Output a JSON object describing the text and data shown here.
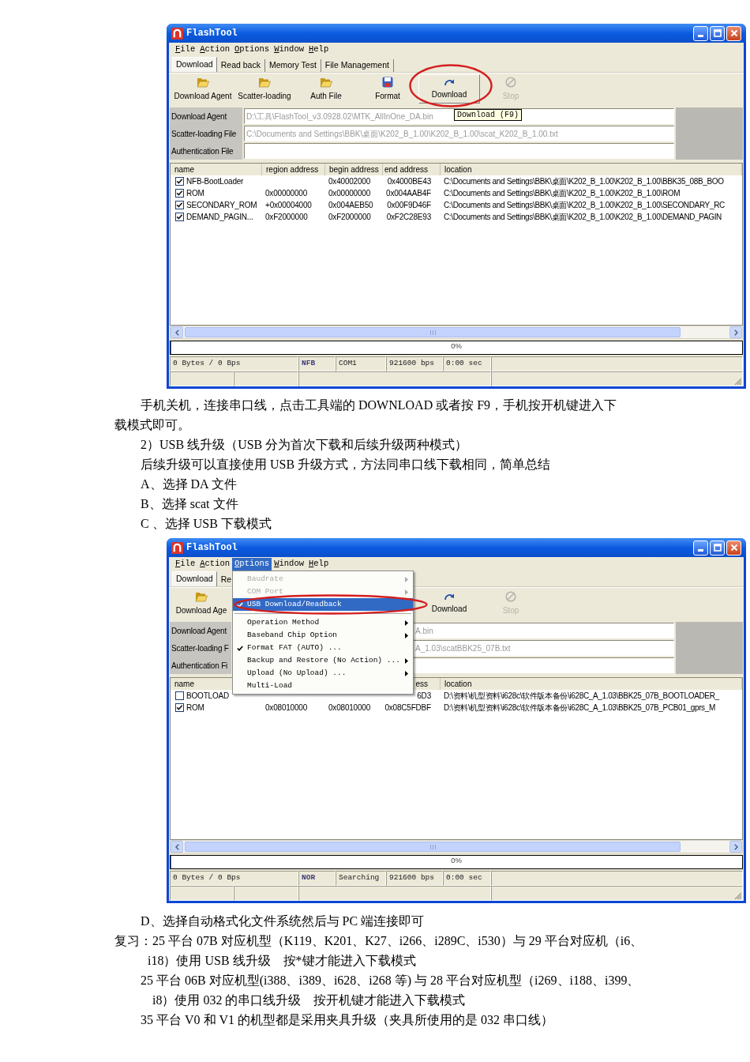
{
  "screenshot_1": {
    "title": "FlashTool",
    "menu_bar": [
      {
        "label": "File",
        "selected": false
      },
      {
        "label": "Action",
        "selected": false
      },
      {
        "label": "Options",
        "selected": false
      },
      {
        "label": "Window",
        "selected": false
      },
      {
        "label": "Help",
        "selected": false
      }
    ],
    "tabs": [
      {
        "label": "Download",
        "selected": true
      },
      {
        "label": "Read back",
        "selected": false
      },
      {
        "label": "Memory Test",
        "selected": false
      },
      {
        "label": "File Management",
        "selected": false
      }
    ],
    "toolbar": [
      {
        "label": "Download Agent",
        "kind": "folder",
        "disabled": false,
        "highlighted": false,
        "circled": false
      },
      {
        "label": "Scatter-loading",
        "kind": "folder",
        "disabled": false,
        "highlighted": false,
        "circled": false
      },
      {
        "label": "Auth File",
        "kind": "folder",
        "disabled": false,
        "highlighted": false,
        "circled": false
      },
      {
        "label": "Format",
        "kind": "format",
        "disabled": false,
        "highlighted": false,
        "circled": false
      },
      {
        "label": "Download",
        "kind": "download",
        "disabled": false,
        "highlighted": true,
        "circled": true
      },
      {
        "label": "Stop",
        "kind": "stop",
        "disabled": true,
        "highlighted": false,
        "circled": false
      }
    ],
    "tooltip": "Download (F9)",
    "fields": [
      {
        "label": "Download Agent",
        "value": "D:\\工具\\FlashTool_v3.0928.02\\MTK_AllInOne_DA.bin"
      },
      {
        "label": "Scatter-loading File",
        "value": "C:\\Documents and Settings\\BBK\\桌面\\K202_B_1.00\\K202_B_1.00\\scat_K202_B_1.00.txt"
      },
      {
        "label": "Authentication File"
      }
    ],
    "table": {
      "columns": {
        "name": "name",
        "region_address": "region address",
        "begin_address": "begin address",
        "end_address": "end address",
        "location": "location"
      },
      "rows": [
        {
          "checked": true,
          "name": "NFB-BootLoader",
          "begin_address": "0x40002000",
          "end_address": "0x4000BE43",
          "location": "C:\\Documents and Settings\\BBK\\桌面\\K202_B_1.00\\K202_B_1.00\\BBK35_08B_BOO"
        },
        {
          "checked": true,
          "name": "ROM",
          "region_address": "0x00000000",
          "begin_address": "0x00000000",
          "end_address": "0x004AAB4F",
          "location": "C:\\Documents and Settings\\BBK\\桌面\\K202_B_1.00\\K202_B_1.00\\ROM"
        },
        {
          "checked": true,
          "name": "SECONDARY_ROM",
          "region_address": "+0x00004000",
          "begin_address": "0x004AEB50",
          "end_address": "0x00F9D46F",
          "location": "C:\\Documents and Settings\\BBK\\桌面\\K202_B_1.00\\K202_B_1.00\\SECONDARY_RC"
        },
        {
          "checked": true,
          "name": "DEMAND_PAGIN...",
          "region_address": "0xF2000000",
          "begin_address": "0xF2000000",
          "end_address": "0xF2C28E93",
          "location": "C:\\Documents and Settings\\BBK\\桌面\\K202_B_1.00\\K202_B_1.00\\DEMAND_PAGIN"
        }
      ]
    },
    "progress": {
      "level": 0,
      "text": "0%"
    },
    "status_bar": [
      "0 Bytes / 0 Bps",
      "NFB",
      "COM1",
      "921600 bps",
      "0:00 sec"
    ]
  },
  "text_1": [
    {
      "kind": "indent",
      "text": "手机关机，连接串口线，点击工具端的 DOWNLOAD 或者按 F9，手机按开机键进入下载模式即可。"
    },
    {
      "kind": "line",
      "text": "2）USB 线升级（USB 分为首次下载和后续升级两种模式）"
    },
    {
      "kind": "line",
      "text": "后续升级可以直接使用 USB 升级方式，方法同串口线下载相同，简单总结"
    },
    {
      "kind": "line",
      "text": "A、选择 DA 文件"
    },
    {
      "kind": "line",
      "text": "B、选择 scat 文件"
    },
    {
      "kind": "line",
      "text": "C 、选择 USB 下载模式"
    }
  ],
  "screenshot_2": {
    "title": "FlashTool",
    "menu_bar": [
      {
        "label": "File",
        "selected": false
      },
      {
        "label": "Action",
        "selected": false
      },
      {
        "label": "Options",
        "selected": true
      },
      {
        "label": "Window",
        "selected": false
      },
      {
        "label": "Help",
        "selected": false
      }
    ],
    "menu_dropdown": [
      {
        "kind": "item",
        "label": "Baudrate",
        "disabled": true,
        "checked": false,
        "submenu": true,
        "selected": false,
        "circled": false
      },
      {
        "kind": "item",
        "label": "COM Port",
        "disabled": true,
        "checked": false,
        "submenu": true,
        "selected": false,
        "circled": false
      },
      {
        "kind": "item",
        "label": "USB Download/Readback",
        "disabled": false,
        "checked": true,
        "submenu": false,
        "selected": true,
        "circled": true
      },
      {
        "kind": "separator"
      },
      {
        "kind": "item",
        "label": "Operation Method",
        "disabled": false,
        "checked": false,
        "submenu": true,
        "selected": false,
        "circled": false
      },
      {
        "kind": "item",
        "label": "Baseband Chip Option",
        "disabled": false,
        "checked": false,
        "submenu": true,
        "selected": false,
        "circled": false
      },
      {
        "kind": "item",
        "label": "Format FAT (AUTO) ...",
        "disabled": false,
        "checked": true,
        "submenu": false,
        "selected": false,
        "circled": false
      },
      {
        "kind": "item",
        "label": "Backup and Restore (No Action) ...",
        "disabled": false,
        "checked": false,
        "submenu": true,
        "selected": false,
        "circled": false
      },
      {
        "kind": "item",
        "label": "Upload (No Upload) ...",
        "disabled": false,
        "checked": false,
        "submenu": true,
        "selected": false,
        "circled": false
      },
      {
        "kind": "item",
        "label": "Multi-Load",
        "disabled": false,
        "checked": false,
        "submenu": false,
        "selected": false,
        "circled": false
      }
    ],
    "tabs": [
      {
        "label": "Download",
        "selected": true
      },
      {
        "label": "Re",
        "selected": false
      }
    ],
    "toolbar": [
      {
        "label": "Download Age",
        "kind": "folder",
        "disabled": false,
        "highlighted": false,
        "circled": false
      },
      {
        "label": "Download",
        "kind": "download",
        "disabled": false,
        "highlighted": false,
        "circled": false
      },
      {
        "label": "Stop",
        "kind": "stop",
        "disabled": true,
        "highlighted": false,
        "circled": false
      }
    ],
    "fields": [
      {
        "label": "Download Agent",
        "value": "A.bin"
      },
      {
        "label": "Scatter-loading F",
        "value": "A_1.03\\scatBBK25_07B.txt"
      },
      {
        "label": "Authentication Fi"
      }
    ],
    "table": {
      "columns": {
        "name": "name",
        "column_4": "ess",
        "location": "location"
      },
      "rows": [
        {
          "checked": false,
          "name": "BOOTLOAD",
          "column_4": "6D3",
          "location": "D:\\资料\\机型资料\\i628c\\软件版本备份\\i628C_A_1.03\\BBK25_07B_BOOTLOADER_"
        },
        {
          "checked": true,
          "name": "ROM",
          "column_2": "0x08010000",
          "column_3": "0x08010000",
          "column_4": "0x08C5FDBF",
          "location": "D:\\资料\\机型资料\\i628c\\软件版本备份\\i628C_A_1.03\\BBK25_07B_PCB01_gprs_M"
        }
      ]
    },
    "progress": {
      "level": 0,
      "text": "0%"
    },
    "status_bar": [
      "0 Bytes / 0 Bps",
      "NOR",
      "Searching",
      "921600 bps",
      "0:00 sec"
    ]
  },
  "text_2": [
    {
      "kind": "line",
      "text": "D、选择自动格式化文件系统然后与 PC 端连接即可"
    },
    {
      "kind": "hanging",
      "text": "复习：25 平台 07B 对应机型（K119、K201、K27、i266、i289C、i530）与 29 平台对应机（i6、i18）使用 USB 线升级　按*键才能进入下载模式"
    },
    {
      "kind": "nested",
      "text": "25 平台 06B 对应机型(i388、i389、i628、i268 等) 与 28 平台对应机型（i269、i188、i399、i8）使用 032 的串口线升级　按开机键才能进入下载模式"
    },
    {
      "kind": "line",
      "text": "35 平台 V0 和 V1 的机型都是采用夹具升级（夹具所使用的是 032 串口线）"
    }
  ]
}
